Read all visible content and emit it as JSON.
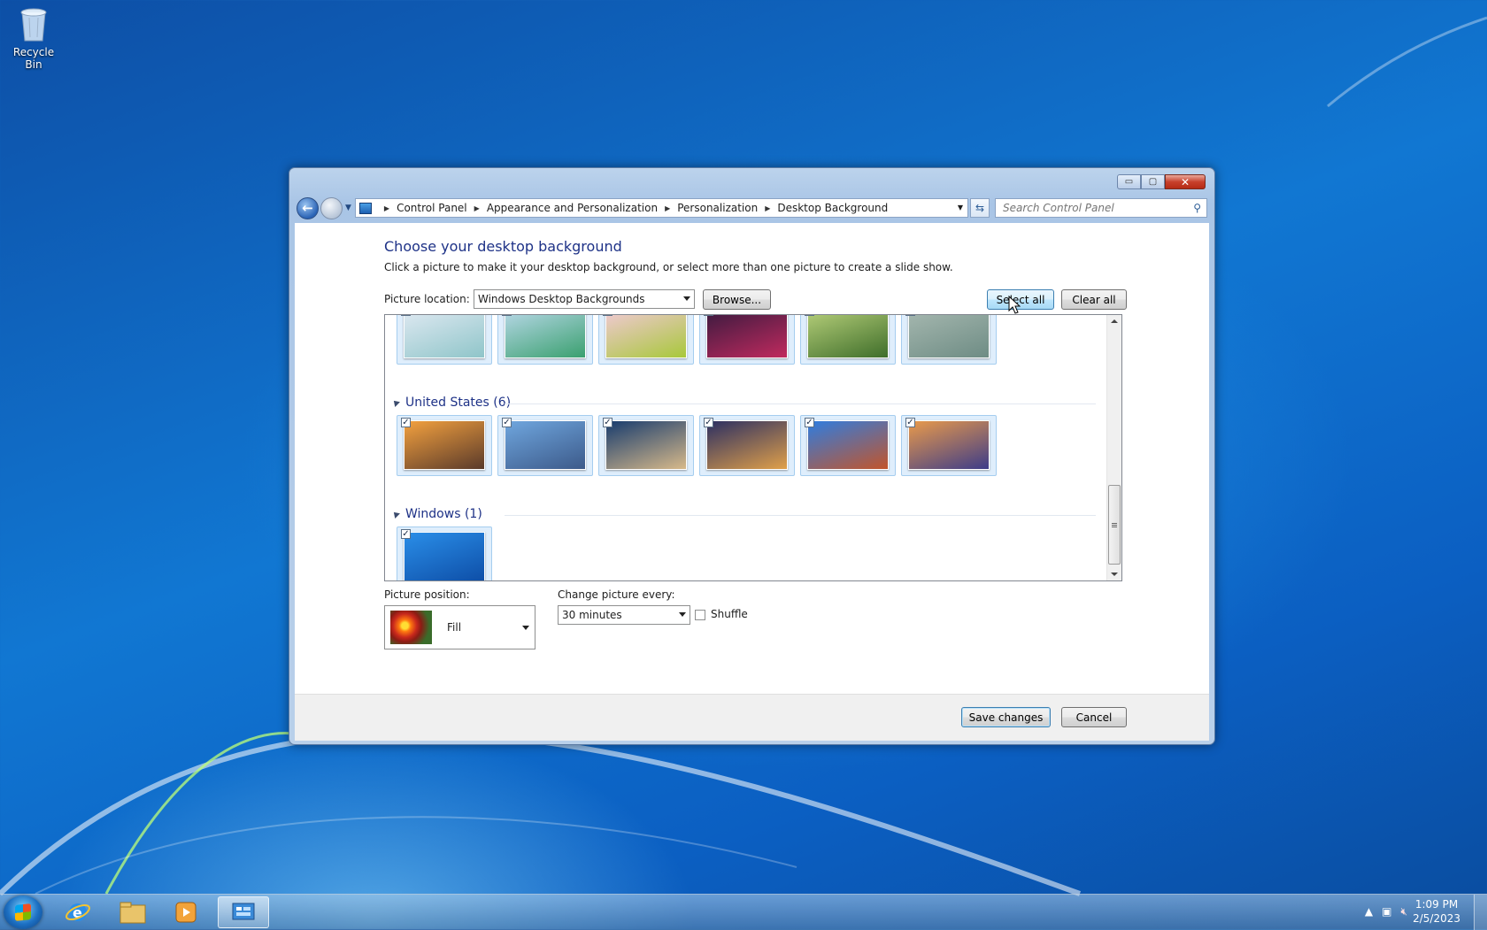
{
  "desktop": {
    "icons": [
      {
        "label": "Recycle Bin",
        "icon": "recycle-bin-icon"
      }
    ]
  },
  "window": {
    "controls": {
      "minimize": "▭",
      "maximize": "▢",
      "close": "✕"
    },
    "address": {
      "crumbs": [
        "Control Panel",
        "Appearance and Personalization",
        "Personalization",
        "Desktop Background"
      ]
    },
    "search": {
      "placeholder": "Search Control Panel"
    }
  },
  "page": {
    "title": "Choose your desktop background",
    "subtitle": "Click a picture to make it your desktop background, or select more than one picture to create a slide show.",
    "picture_location_label": "Picture location:",
    "picture_location_value": "Windows Desktop Backgrounds",
    "browse_label": "Browse...",
    "select_all_label": "Select all",
    "clear_all_label": "Clear all"
  },
  "gallery": {
    "groups": [
      {
        "header": "",
        "count_checked": 6,
        "colors": [
          [
            "#dfe9f2",
            "#8fc5c9"
          ],
          [
            "#b8d8e8",
            "#3aa06f"
          ],
          [
            "#f2c9d6",
            "#a8c83a"
          ],
          [
            "#3a1a3f",
            "#c02a5e"
          ],
          [
            "#b6cf7a",
            "#3f6e2a"
          ],
          [
            "#a6b8b0",
            "#6e8c84"
          ]
        ]
      },
      {
        "header": "United States (6)",
        "count_checked": 6,
        "colors": [
          [
            "#f3a13f",
            "#5a3a2a"
          ],
          [
            "#6fa6de",
            "#3c5a8a"
          ],
          [
            "#183c6e",
            "#d7b98a"
          ],
          [
            "#2c2f62",
            "#e0a04a"
          ],
          [
            "#2f7de0",
            "#c2552b"
          ],
          [
            "#e99a4b",
            "#3d3c88"
          ]
        ]
      },
      {
        "header": "Windows (1)",
        "count_checked": 1,
        "colors": [
          [
            "#2a8ee8",
            "#0e4fa8"
          ]
        ]
      }
    ]
  },
  "settings": {
    "picture_position_label": "Picture position:",
    "picture_position_value": "Fill",
    "change_every_label": "Change picture every:",
    "change_every_value": "30 minutes",
    "shuffle_label": "Shuffle",
    "shuffle_checked": false
  },
  "footer": {
    "save_label": "Save changes",
    "cancel_label": "Cancel"
  },
  "taskbar": {
    "items": [
      "internet-explorer-icon",
      "file-explorer-icon",
      "media-player-icon",
      "control-panel-icon"
    ],
    "time": "1:09 PM",
    "date": "2/5/2023"
  }
}
